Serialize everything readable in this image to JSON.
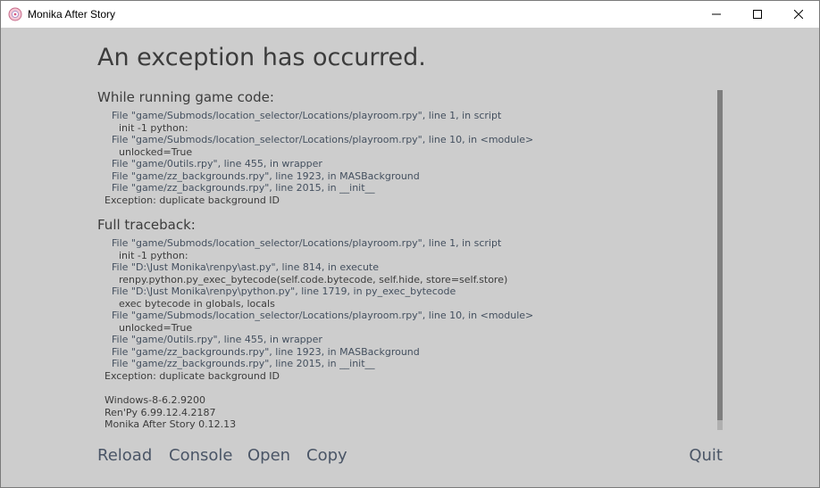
{
  "window": {
    "title": "Monika After Story"
  },
  "error": {
    "heading": "An exception has occurred.",
    "while_running_title": "While running game code:",
    "while_running_lines": [
      {
        "kind": "file",
        "text": "File \"game/Submods/location_selector/Locations/playroom.rpy\", line 1, in script"
      },
      {
        "kind": "code",
        "text": "init -1 python:"
      },
      {
        "kind": "file",
        "text": "File \"game/Submods/location_selector/Locations/playroom.rpy\", line 10, in <module>"
      },
      {
        "kind": "code",
        "text": "unlocked=True"
      },
      {
        "kind": "file",
        "text": "File \"game/0utils.rpy\", line 455, in wrapper"
      },
      {
        "kind": "file",
        "text": "File \"game/zz_backgrounds.rpy\", line 1923, in MASBackground"
      },
      {
        "kind": "file",
        "text": "File \"game/zz_backgrounds.rpy\", line 2015, in __init__"
      },
      {
        "kind": "exc",
        "text": "Exception: duplicate background ID"
      }
    ],
    "full_traceback_title": "Full traceback:",
    "full_traceback_lines": [
      {
        "kind": "file",
        "text": "File \"game/Submods/location_selector/Locations/playroom.rpy\", line 1, in script"
      },
      {
        "kind": "code",
        "text": "init -1 python:"
      },
      {
        "kind": "file",
        "text": "File \"D:\\Just Monika\\renpy\\ast.py\", line 814, in execute"
      },
      {
        "kind": "code",
        "text": "renpy.python.py_exec_bytecode(self.code.bytecode, self.hide, store=self.store)"
      },
      {
        "kind": "file",
        "text": "File \"D:\\Just Monika\\renpy\\python.py\", line 1719, in py_exec_bytecode"
      },
      {
        "kind": "code",
        "text": "exec bytecode in globals, locals"
      },
      {
        "kind": "file",
        "text": "File \"game/Submods/location_selector/Locations/playroom.rpy\", line 10, in <module>"
      },
      {
        "kind": "code",
        "text": "unlocked=True"
      },
      {
        "kind": "file",
        "text": "File \"game/0utils.rpy\", line 455, in wrapper"
      },
      {
        "kind": "file",
        "text": "File \"game/zz_backgrounds.rpy\", line 1923, in MASBackground"
      },
      {
        "kind": "file",
        "text": "File \"game/zz_backgrounds.rpy\", line 2015, in __init__"
      },
      {
        "kind": "exc",
        "text": "Exception: duplicate background ID"
      }
    ],
    "system_info": [
      "Windows-8-6.2.9200",
      "Ren'Py 6.99.12.4.2187",
      "Monika After Story 0.12.13"
    ]
  },
  "actions": {
    "reload": "Reload",
    "console": "Console",
    "open": "Open",
    "copy": "Copy",
    "quit": "Quit"
  },
  "icons": {
    "app": "monika-app-icon",
    "minimize": "minimize-icon",
    "maximize": "maximize-icon",
    "close": "close-icon"
  }
}
